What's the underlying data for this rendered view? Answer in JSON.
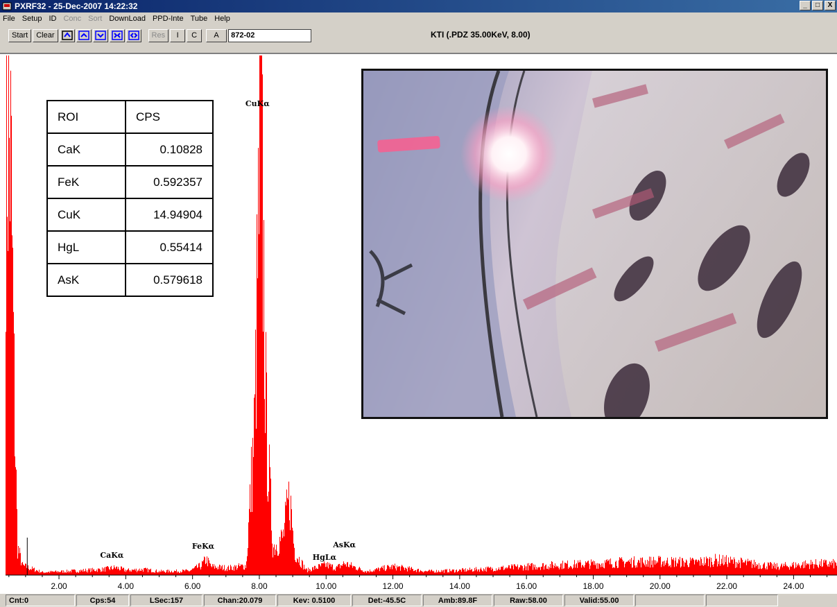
{
  "titlebar": {
    "title": "PXRF32 - 25-Dec-2007 14:22:32",
    "app_icon": "pxrf-app-icon",
    "buttons": [
      "_",
      "□",
      "X"
    ]
  },
  "menu": [
    {
      "label": "File",
      "enabled": true
    },
    {
      "label": "Setup",
      "enabled": true
    },
    {
      "label": "ID",
      "enabled": true
    },
    {
      "label": "Conc",
      "enabled": false
    },
    {
      "label": "Sort",
      "enabled": false
    },
    {
      "label": "DownLoad",
      "enabled": true
    },
    {
      "label": "PPD-Inte",
      "enabled": true
    },
    {
      "label": "Tube",
      "enabled": true
    },
    {
      "label": "Help",
      "enabled": true
    }
  ],
  "toolbar": {
    "start_label": "Start",
    "clear_label": "Clear",
    "icons": [
      "stack-icon",
      "arrow-up-icon",
      "arrow-down-icon",
      "contract-icon",
      "expand-icon"
    ],
    "res_label": "Res",
    "i_label": "I",
    "c_label": "C",
    "a_label": "A",
    "sample_value": "872-02",
    "status": "KTI  (.PDZ 35.00KeV, 8.00)"
  },
  "roi_table": {
    "headers": [
      "ROI",
      "CPS"
    ],
    "rows": [
      [
        "CaK",
        "0.10828"
      ],
      [
        "FeK",
        "0.592357"
      ],
      [
        "CuK",
        "14.94904"
      ],
      [
        "HgL",
        "0.55414"
      ],
      [
        "AsK",
        "0.579618"
      ]
    ]
  },
  "chart_data": {
    "type": "area",
    "xlabel": "",
    "ylabel": "",
    "xlim": [
      0.4,
      25.3
    ],
    "ylim": [
      0,
      100
    ],
    "x_ticks": [
      "2.00",
      "4.00",
      "6.00",
      "8.00",
      "10.00",
      "12.00",
      "14.00",
      "16.00",
      "18.00",
      "20.00",
      "22.00",
      "24.00"
    ],
    "x_tick_values": [
      2,
      4,
      6,
      8,
      10,
      12,
      14,
      16,
      18,
      20,
      22,
      24
    ],
    "series_color": "#ff0000",
    "peaks": [
      {
        "label": "CaKα",
        "energy": 3.69
      },
      {
        "label": "FeKα",
        "energy": 6.4
      },
      {
        "label": "CuKα",
        "energy": 8.04
      },
      {
        "label": "HgLα",
        "energy": 9.99
      },
      {
        "label": "AsKα",
        "energy": 10.54
      }
    ],
    "cursor_kev": 0.51,
    "spectrum": [
      {
        "x": 0.45,
        "y": 95
      },
      {
        "x": 0.55,
        "y": 88
      },
      {
        "x": 0.65,
        "y": 40
      },
      {
        "x": 0.75,
        "y": 6
      },
      {
        "x": 0.9,
        "y": 2
      },
      {
        "x": 1.5,
        "y": 0.6
      },
      {
        "x": 2.5,
        "y": 0.9
      },
      {
        "x": 3.3,
        "y": 1.2
      },
      {
        "x": 3.69,
        "y": 1.6
      },
      {
        "x": 4.0,
        "y": 1.0
      },
      {
        "x": 4.5,
        "y": 1.2
      },
      {
        "x": 5.0,
        "y": 0.8
      },
      {
        "x": 5.9,
        "y": 0.9
      },
      {
        "x": 6.25,
        "y": 2.0
      },
      {
        "x": 6.4,
        "y": 3.4
      },
      {
        "x": 6.55,
        "y": 1.8
      },
      {
        "x": 7.06,
        "y": 1.5
      },
      {
        "x": 7.6,
        "y": 2.0
      },
      {
        "x": 7.85,
        "y": 32
      },
      {
        "x": 8.04,
        "y": 100
      },
      {
        "x": 8.2,
        "y": 32
      },
      {
        "x": 8.4,
        "y": 6
      },
      {
        "x": 8.7,
        "y": 8
      },
      {
        "x": 8.9,
        "y": 17
      },
      {
        "x": 9.05,
        "y": 5
      },
      {
        "x": 9.4,
        "y": 1.0
      },
      {
        "x": 9.99,
        "y": 2.2
      },
      {
        "x": 10.3,
        "y": 1.5
      },
      {
        "x": 10.54,
        "y": 2.5
      },
      {
        "x": 11.2,
        "y": 0.8
      },
      {
        "x": 12.0,
        "y": 1.8
      },
      {
        "x": 13.0,
        "y": 0.8
      },
      {
        "x": 14.0,
        "y": 1.0
      },
      {
        "x": 15.0,
        "y": 1.4
      },
      {
        "x": 16.0,
        "y": 1.8
      },
      {
        "x": 17.0,
        "y": 2.2
      },
      {
        "x": 18.0,
        "y": 2.4
      },
      {
        "x": 19.0,
        "y": 2.8
      },
      {
        "x": 20.0,
        "y": 2.9
      },
      {
        "x": 21.0,
        "y": 2.7
      },
      {
        "x": 21.7,
        "y": 3.2
      },
      {
        "x": 22.5,
        "y": 2.6
      },
      {
        "x": 23.5,
        "y": 1.8
      },
      {
        "x": 24.5,
        "y": 2.4
      },
      {
        "x": 25.3,
        "y": 2.4
      }
    ]
  },
  "statusbar": [
    "Cnt:0",
    "Cps:54",
    "LSec:157",
    "Chan:20.079",
    "Kev: 0.5100",
    "Det:-45.5C",
    "Amb:89.8F",
    "Raw:58.00",
    "Valid:55.00",
    "",
    ""
  ]
}
